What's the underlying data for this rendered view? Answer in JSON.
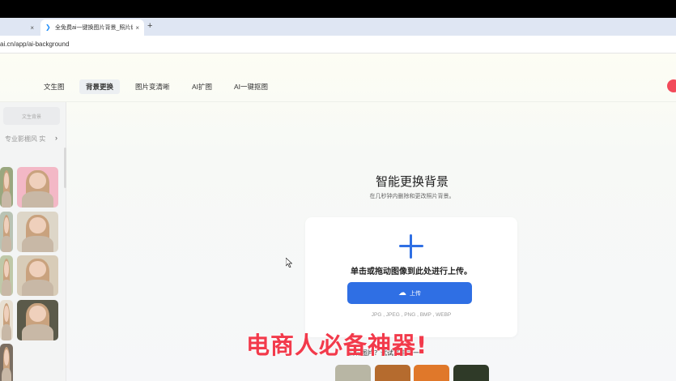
{
  "browser": {
    "tabs": [
      {
        "label": "",
        "active": false
      },
      {
        "label": "全免费ai一键换图片背景_照片编",
        "active": true
      }
    ],
    "close_glyph": "×",
    "new_tab_glyph": "+",
    "favicon_glyph": "❯",
    "url": "ai.cn/app/ai-background"
  },
  "nav": {
    "items": [
      {
        "label": "文生图",
        "active": false
      },
      {
        "label": "背景更换",
        "active": true
      },
      {
        "label": "图片变清晰",
        "active": false
      },
      {
        "label": "AI扩图",
        "active": false
      },
      {
        "label": "AI一键抠图",
        "active": false
      }
    ]
  },
  "sidebar": {
    "button_label": "文生背景",
    "categories": "专业影棚风  实",
    "chevron": "›"
  },
  "main": {
    "title": "智能更换背景",
    "subtitle": "在几秒钟内删除和更改照片背景。",
    "upload_prompt": "单击或拖动图像到此处进行上传。",
    "upload_button": "上传",
    "upload_icon": "☁",
    "formats": "JPG , JPEG , PNG , BMP , WEBP",
    "samples_text": "没有图片？试试其中之一"
  },
  "overlay_caption": "电商人必备神器!",
  "colors": {
    "accent": "#2f6fe4",
    "overlay": "#f23a4b"
  }
}
